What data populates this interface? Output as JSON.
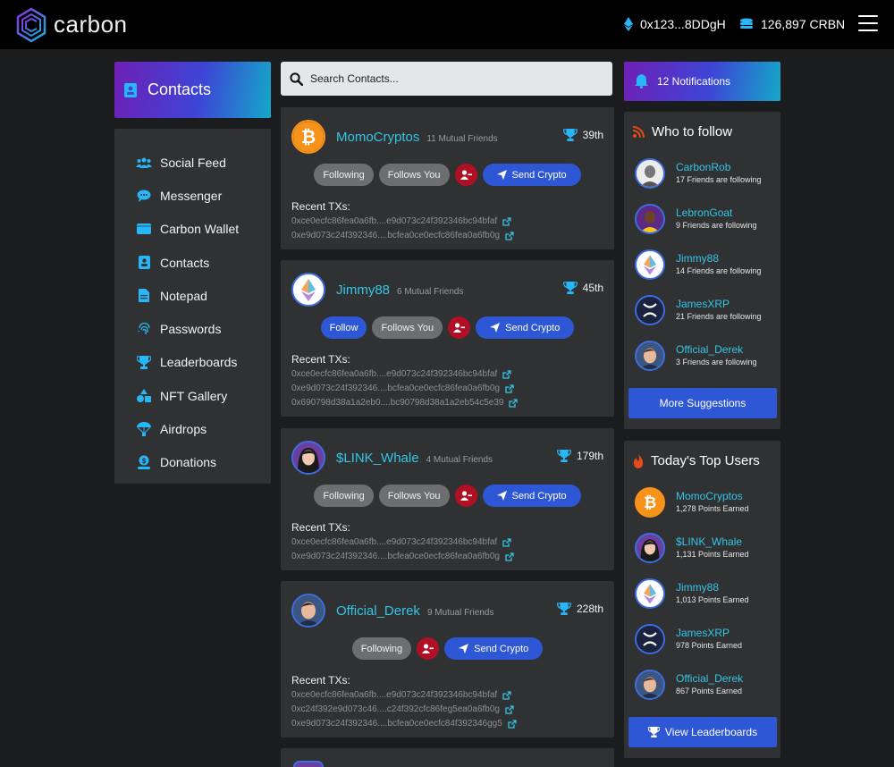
{
  "header": {
    "brand": "carbon",
    "wallet_address": "0x123...8DDgH",
    "balance": "126,897 CRBN"
  },
  "sidebar": {
    "title": "Contacts",
    "items": [
      {
        "label": "Social Feed",
        "icon": "users-icon"
      },
      {
        "label": "Messenger",
        "icon": "chat-icon"
      },
      {
        "label": "Carbon Wallet",
        "icon": "wallet-icon"
      },
      {
        "label": "Contacts",
        "icon": "contact-card-icon"
      },
      {
        "label": "Notepad",
        "icon": "note-icon"
      },
      {
        "label": "Passwords",
        "icon": "fingerprint-icon"
      },
      {
        "label": "Leaderboards",
        "icon": "trophy-icon"
      },
      {
        "label": "NFT Gallery",
        "icon": "shapes-icon"
      },
      {
        "label": "Airdrops",
        "icon": "parachute-icon"
      },
      {
        "label": "Donations",
        "icon": "donation-icon"
      }
    ]
  },
  "search": {
    "placeholder": "Search Contacts..."
  },
  "contacts": [
    {
      "name": "MomoCryptos",
      "mutual": "11 Mutual Friends",
      "rank": "39th",
      "avatar": "bitcoin-icon",
      "buttons": [
        "Following",
        "Follows You"
      ],
      "send": "Send Crypto",
      "tx_header": "Recent TXs:",
      "txs": [
        "0xce0ecfc86fea0a6fb....e9d073c24f392346bc94bfaf",
        "0xe9d073c24f392346....bcfea0ce0ecfc86fea0a6fb0g"
      ]
    },
    {
      "name": "Jimmy88",
      "mutual": "6 Mutual Friends",
      "rank": "45th",
      "avatar": "ethereum-icon",
      "buttons": [
        "Follow",
        "Follows You"
      ],
      "send": "Send Crypto",
      "tx_header": "Recent TXs:",
      "txs": [
        "0xce0ecfc86fea0a6fb....e9d073c24f392346bc94bfaf",
        "0xe9d073c24f392346....bcfea0ce0ecfc86fea0a6fb0g",
        "0x690798d38a1a2eb0....bc90798d38a1a2eb54c5e39"
      ]
    },
    {
      "name": "$LINK_Whale",
      "mutual": "4 Mutual Friends",
      "rank": "179th",
      "avatar": "woman-avatar",
      "buttons": [
        "Following",
        "Follows You"
      ],
      "send": "Send Crypto",
      "tx_header": "Recent TXs:",
      "txs": [
        "0xce0ecfc86fea0a6fb....e9d073c24f392346bc94bfaf",
        "0xe9d073c24f392346....bcfea0ce0ecfc86fea0a6fb0g"
      ]
    },
    {
      "name": "Official_Derek",
      "mutual": "9 Mutual Friends",
      "rank": "228th",
      "avatar": "man-avatar",
      "buttons": [
        "Following"
      ],
      "send": "Send Crypto",
      "tx_header": "Recent TXs:",
      "txs": [
        "0xce0ecfc86fea0a6fb....e9d073c24f392346bc94bfaf",
        "0xc24f392e9d073c46....c24f392cfc86feg5ea0a6fb0g",
        "0xe9d073c24f392346....bcfea0ce0ecfc84f392346gg5"
      ]
    }
  ],
  "notifications": {
    "label": "12 Notifications"
  },
  "who_to_follow": {
    "title": "Who to follow",
    "people": [
      {
        "name": "CarbonRob",
        "sub": "17 Friends are following"
      },
      {
        "name": "LebronGoat",
        "sub": "9 Friends are following"
      },
      {
        "name": "Jimmy88",
        "sub": "14 Friends are following"
      },
      {
        "name": "JamesXRP",
        "sub": "21 Friends are following"
      },
      {
        "name": "Official_Derek",
        "sub": "3 Friends are following"
      }
    ],
    "button": "More Suggestions"
  },
  "top_users": {
    "title": "Today's Top Users",
    "people": [
      {
        "name": "MomoCryptos",
        "sub": "1,278 Points Earned"
      },
      {
        "name": "$LINK_Whale",
        "sub": "1,131 Points Earned"
      },
      {
        "name": "Jimmy88",
        "sub": "1,013 Points Earned"
      },
      {
        "name": "JamesXRP",
        "sub": "978 Points Earned"
      },
      {
        "name": "Official_Derek",
        "sub": "867 Points Earned"
      }
    ],
    "button": "View Leaderboards"
  },
  "colors": {
    "accent_cyan": "#34c5e6",
    "accent_blue": "#2e57d6",
    "danger_red": "#b10f24",
    "panel": "#2f3133",
    "background": "#1b1c1e"
  }
}
